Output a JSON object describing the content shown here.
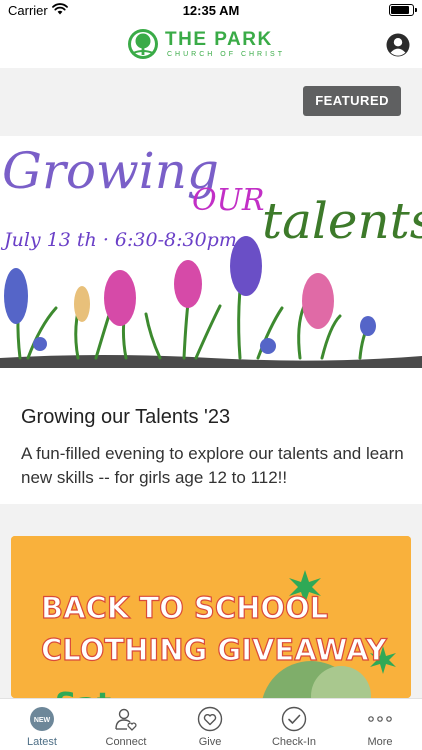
{
  "status_bar": {
    "carrier": "Carrier",
    "time": "12:35 AM"
  },
  "header": {
    "logo_name": "THE PARK",
    "logo_sub": "CHURCH OF CHRIST",
    "brand_color": "#3aab47"
  },
  "featured_label": "FEATURED",
  "cards": [
    {
      "banner": {
        "headline_script": "Growing",
        "headline_accent": "OUR",
        "headline_end": "talents",
        "date_line": "July 13 th · 6:30-8:30pm"
      },
      "title": "Growing our Talents '23",
      "description": "A fun-filled evening to explore our talents and learn new skills -- for girls age 12 to 112!!"
    },
    {
      "banner": {
        "line1": "BACK TO SCHOOL",
        "line2": "CLOTHING GIVEAWAY",
        "partial_text": "Sat",
        "background": "#f9b13c"
      }
    }
  ],
  "tabs": [
    {
      "label": "Latest",
      "icon": "new-badge-icon",
      "badge": "NEW",
      "active": true
    },
    {
      "label": "Connect",
      "icon": "person-heart-icon",
      "active": false
    },
    {
      "label": "Give",
      "icon": "heart-circle-icon",
      "active": false
    },
    {
      "label": "Check-In",
      "icon": "check-circle-icon",
      "active": false
    },
    {
      "label": "More",
      "icon": "more-dots-icon",
      "active": false
    }
  ]
}
